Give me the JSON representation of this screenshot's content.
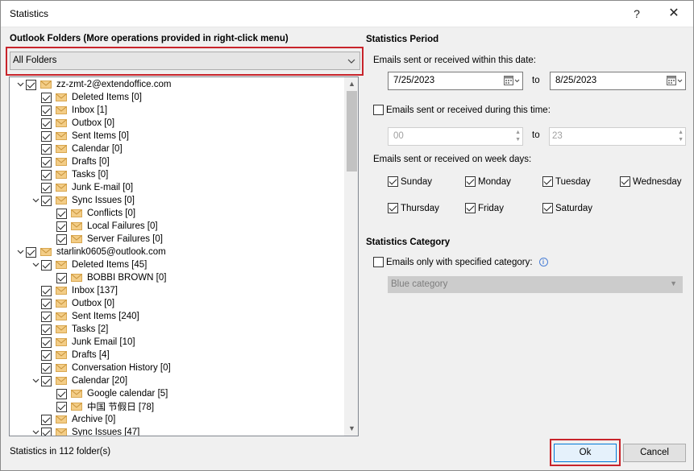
{
  "window": {
    "title": "Statistics",
    "help_glyph": "?",
    "close_glyph": "✕"
  },
  "folders": {
    "heading": "Outlook Folders (More operations provided in right-click menu)",
    "filter_value": "All Folders",
    "tree": [
      {
        "label": "zz-zmt-2@extendoffice.com",
        "level": 0,
        "expanded": true,
        "icon": "mail-icon",
        "checked": true
      },
      {
        "label": "Deleted Items [0]",
        "level": 1,
        "icon": "folder-envelope-icon",
        "checked": true
      },
      {
        "label": "Inbox [1]",
        "level": 1,
        "icon": "folder-envelope-icon",
        "checked": true
      },
      {
        "label": "Outbox [0]",
        "level": 1,
        "icon": "folder-envelope-icon",
        "checked": true
      },
      {
        "label": "Sent Items [0]",
        "level": 1,
        "icon": "folder-envelope-icon",
        "checked": true
      },
      {
        "label": "Calendar [0]",
        "level": 1,
        "icon": "folder-envelope-icon",
        "checked": true
      },
      {
        "label": "Drafts [0]",
        "level": 1,
        "icon": "folder-envelope-icon",
        "checked": true
      },
      {
        "label": "Tasks [0]",
        "level": 1,
        "icon": "folder-envelope-icon",
        "checked": true
      },
      {
        "label": "Junk E-mail [0]",
        "level": 1,
        "icon": "folder-envelope-icon",
        "checked": true
      },
      {
        "label": "Sync Issues [0]",
        "level": 1,
        "expanded": true,
        "icon": "folder-envelope-icon",
        "checked": true
      },
      {
        "label": "Conflicts [0]",
        "level": 2,
        "icon": "folder-envelope-icon",
        "checked": true
      },
      {
        "label": "Local Failures [0]",
        "level": 2,
        "icon": "folder-envelope-icon",
        "checked": true
      },
      {
        "label": "Server Failures [0]",
        "level": 2,
        "icon": "folder-envelope-icon",
        "checked": true
      },
      {
        "label": "starlink0605@outlook.com",
        "level": 0,
        "expanded": true,
        "icon": "mail-icon",
        "checked": true
      },
      {
        "label": "Deleted Items [45]",
        "level": 1,
        "expanded": true,
        "icon": "folder-envelope-icon",
        "checked": true
      },
      {
        "label": "BOBBI BROWN [0]",
        "level": 2,
        "icon": "folder-envelope-icon",
        "checked": true
      },
      {
        "label": "Inbox [137]",
        "level": 1,
        "icon": "folder-envelope-icon",
        "checked": true
      },
      {
        "label": "Outbox [0]",
        "level": 1,
        "icon": "folder-envelope-icon",
        "checked": true
      },
      {
        "label": "Sent Items [240]",
        "level": 1,
        "icon": "folder-envelope-icon",
        "checked": true
      },
      {
        "label": "Tasks [2]",
        "level": 1,
        "icon": "folder-envelope-icon",
        "checked": true
      },
      {
        "label": "Junk Email [10]",
        "level": 1,
        "icon": "folder-envelope-icon",
        "checked": true
      },
      {
        "label": "Drafts [4]",
        "level": 1,
        "icon": "folder-envelope-icon",
        "checked": true
      },
      {
        "label": "Conversation History [0]",
        "level": 1,
        "icon": "folder-envelope-icon",
        "checked": true
      },
      {
        "label": "Calendar [20]",
        "level": 1,
        "expanded": true,
        "icon": "folder-envelope-icon",
        "checked": true
      },
      {
        "label": "Google calendar [5]",
        "level": 2,
        "icon": "folder-envelope-icon",
        "checked": true
      },
      {
        "label": "中国 节假日 [78]",
        "level": 2,
        "icon": "folder-envelope-icon",
        "checked": true
      },
      {
        "label": "Archive [0]",
        "level": 1,
        "icon": "folder-envelope-icon",
        "checked": true
      },
      {
        "label": "Sync Issues [47]",
        "level": 1,
        "expanded": true,
        "icon": "folder-envelope-icon",
        "checked": true
      }
    ],
    "status": "Statistics in 112 folder(s)"
  },
  "period": {
    "heading": "Statistics Period",
    "date_range_label": "Emails sent or received within this date:",
    "from_date": "7/25/2023",
    "to_label": "to",
    "to_date": "8/25/2023",
    "time_checkbox_label": "Emails sent or received during this time:",
    "time_checked": false,
    "from_hour": "00",
    "to_hour": "23",
    "weekdays_label": "Emails sent or received on week days:",
    "weekdays": [
      {
        "label": "Sunday",
        "checked": true
      },
      {
        "label": "Monday",
        "checked": true
      },
      {
        "label": "Tuesday",
        "checked": true
      },
      {
        "label": "Wednesday",
        "checked": true
      },
      {
        "label": "Thursday",
        "checked": true
      },
      {
        "label": "Friday",
        "checked": true
      },
      {
        "label": "Saturday",
        "checked": true
      }
    ]
  },
  "category": {
    "heading": "Statistics Category",
    "checkbox_label": "Emails only with specified category:",
    "checked": false,
    "selected": "Blue category"
  },
  "buttons": {
    "ok": "Ok",
    "cancel": "Cancel"
  },
  "colors": {
    "highlight": "#c8242b",
    "envelope": "#e8b969",
    "accent": "#0078d7"
  }
}
